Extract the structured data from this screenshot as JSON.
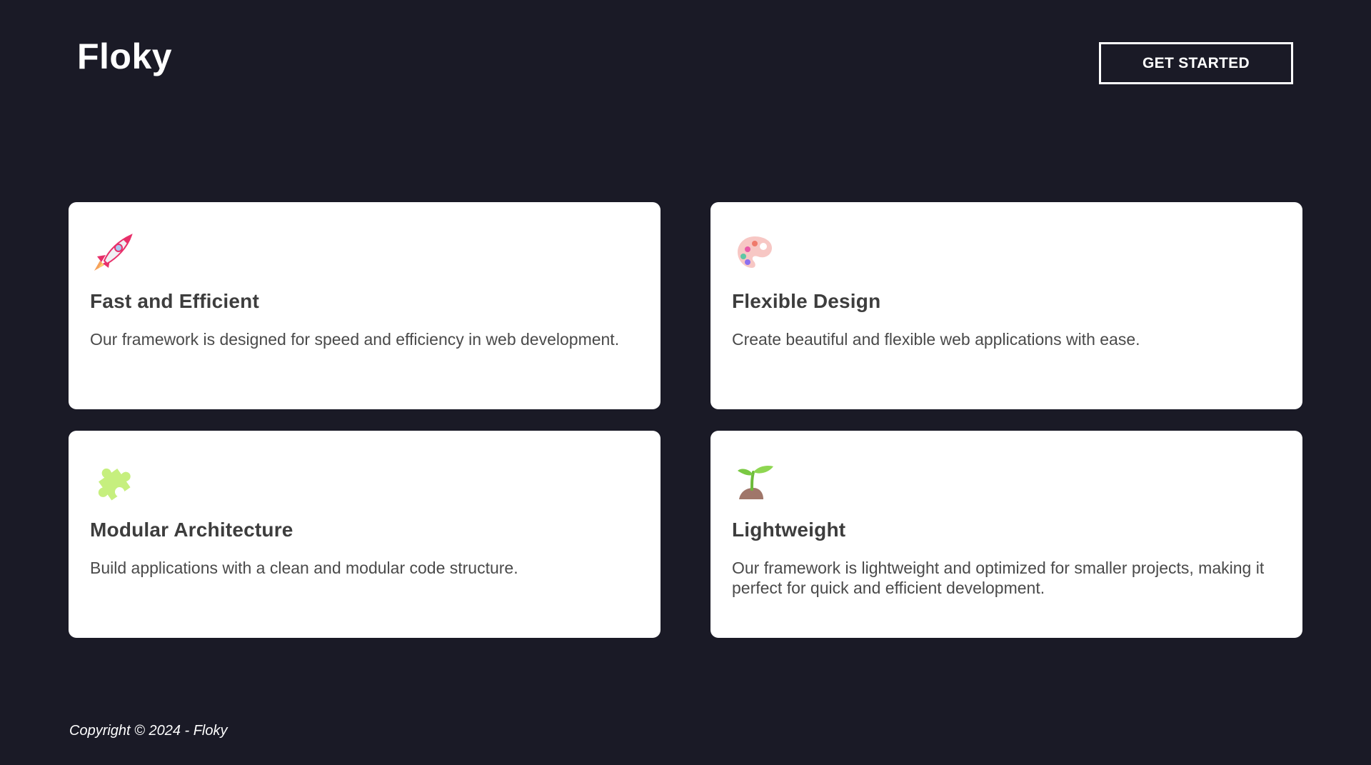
{
  "header": {
    "logo": "Floky",
    "cta_label": "GET STARTED"
  },
  "features": [
    {
      "icon": "rocket-icon",
      "title": "Fast and Efficient",
      "text": "Our framework is designed for speed and efficiency in web development."
    },
    {
      "icon": "palette-icon",
      "title": "Flexible Design",
      "text": "Create beautiful and flexible web applications with ease."
    },
    {
      "icon": "puzzle-piece-icon",
      "title": "Modular Architecture",
      "text": "Build applications with a clean and modular code structure."
    },
    {
      "icon": "seedling-icon",
      "title": "Lightweight",
      "text": "Our framework is lightweight and optimized for smaller projects, making it perfect for quick and efficient development."
    }
  ],
  "footer": {
    "copyright": "Copyright © 2024 - Floky"
  },
  "colors": {
    "background": "#1a1a26",
    "card": "#ffffff",
    "heading": "#3d3d3d",
    "body_text": "#4a4a4a"
  }
}
